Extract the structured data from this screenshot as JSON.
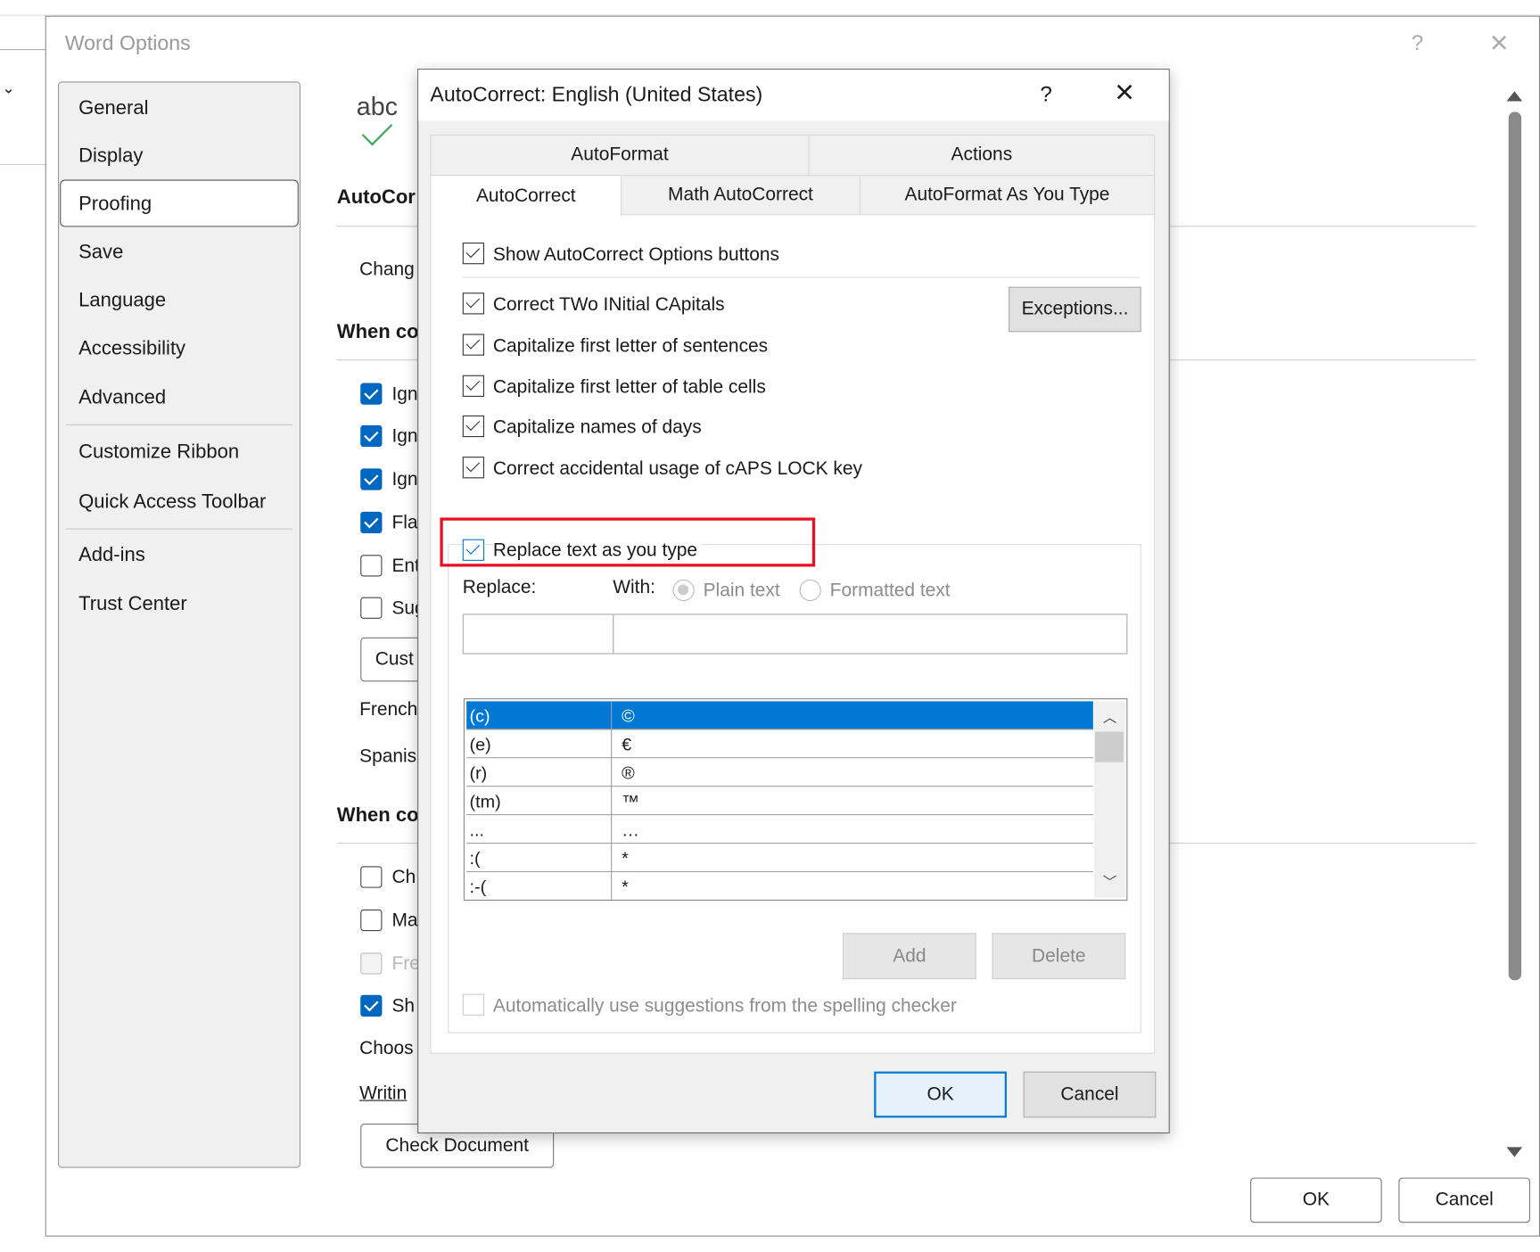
{
  "word_options": {
    "title": "Word Options",
    "help": "?",
    "close": "×",
    "nav": [
      "General",
      "Display",
      "Proofing",
      "Save",
      "Language",
      "Accessibility",
      "Advanced",
      "Customize Ribbon",
      "Quick Access Toolbar",
      "Add-ins",
      "Trust Center"
    ],
    "selected_nav": "Proofing",
    "content": {
      "icon_text": "abc",
      "heading1": "AutoCor",
      "change_text": "Chang",
      "heading2": "When co",
      "options1": [
        {
          "label": "Ign",
          "checked": true
        },
        {
          "label": "Ign",
          "checked": true
        },
        {
          "label": "Ign",
          "checked": true
        },
        {
          "label": "Fla",
          "checked": true
        },
        {
          "label": "Ent",
          "checked": false
        },
        {
          "label": "Sug",
          "checked": false
        }
      ],
      "custom_button": "Cust",
      "french": "French",
      "spanish": "Spanis",
      "heading3": "When co",
      "options2": [
        {
          "label": "Ch",
          "checked": false
        },
        {
          "label": "Ma",
          "checked": false
        },
        {
          "label": "Fre",
          "checked": false,
          "disabled": true
        },
        {
          "label": "Sh",
          "checked": true
        }
      ],
      "choose": "Choos",
      "writing": "Writin",
      "check_document": "Check Document"
    },
    "ok": "OK",
    "cancel": "Cancel"
  },
  "autocorrect": {
    "title": "AutoCorrect: English (United States)",
    "help": "?",
    "close": "×",
    "tabs_row1": [
      "AutoFormat",
      "Actions"
    ],
    "tabs_row2": [
      "AutoCorrect",
      "Math AutoCorrect",
      "AutoFormat As You Type"
    ],
    "selected_tab": "AutoCorrect",
    "show_buttons": "Show AutoCorrect Options buttons",
    "options": [
      "Correct TWo INitial CApitals",
      "Capitalize first letter of sentences",
      "Capitalize first letter of table cells",
      "Capitalize names of days",
      "Correct accidental usage of cAPS LOCK key"
    ],
    "exceptions": "Exceptions...",
    "replace_as_type": "Replace text as you type",
    "replace_label": "Replace:",
    "with_label": "With:",
    "plain_text": "Plain text",
    "formatted_text": "Formatted text",
    "replace_value": "",
    "with_value": "",
    "entries": [
      [
        "(c)",
        "©"
      ],
      [
        "(e)",
        "€"
      ],
      [
        "(r)",
        "®"
      ],
      [
        "(tm)",
        "™"
      ],
      [
        "...",
        "…"
      ],
      [
        ":(",
        "*"
      ],
      [
        ":-(",
        "*"
      ]
    ],
    "selected_entry": 0,
    "add": "Add",
    "delete": "Delete",
    "auto_suggest": "Automatically use suggestions from the spelling checker",
    "ok": "OK",
    "cancel": "Cancel",
    "highlight_color": "#e81123"
  }
}
